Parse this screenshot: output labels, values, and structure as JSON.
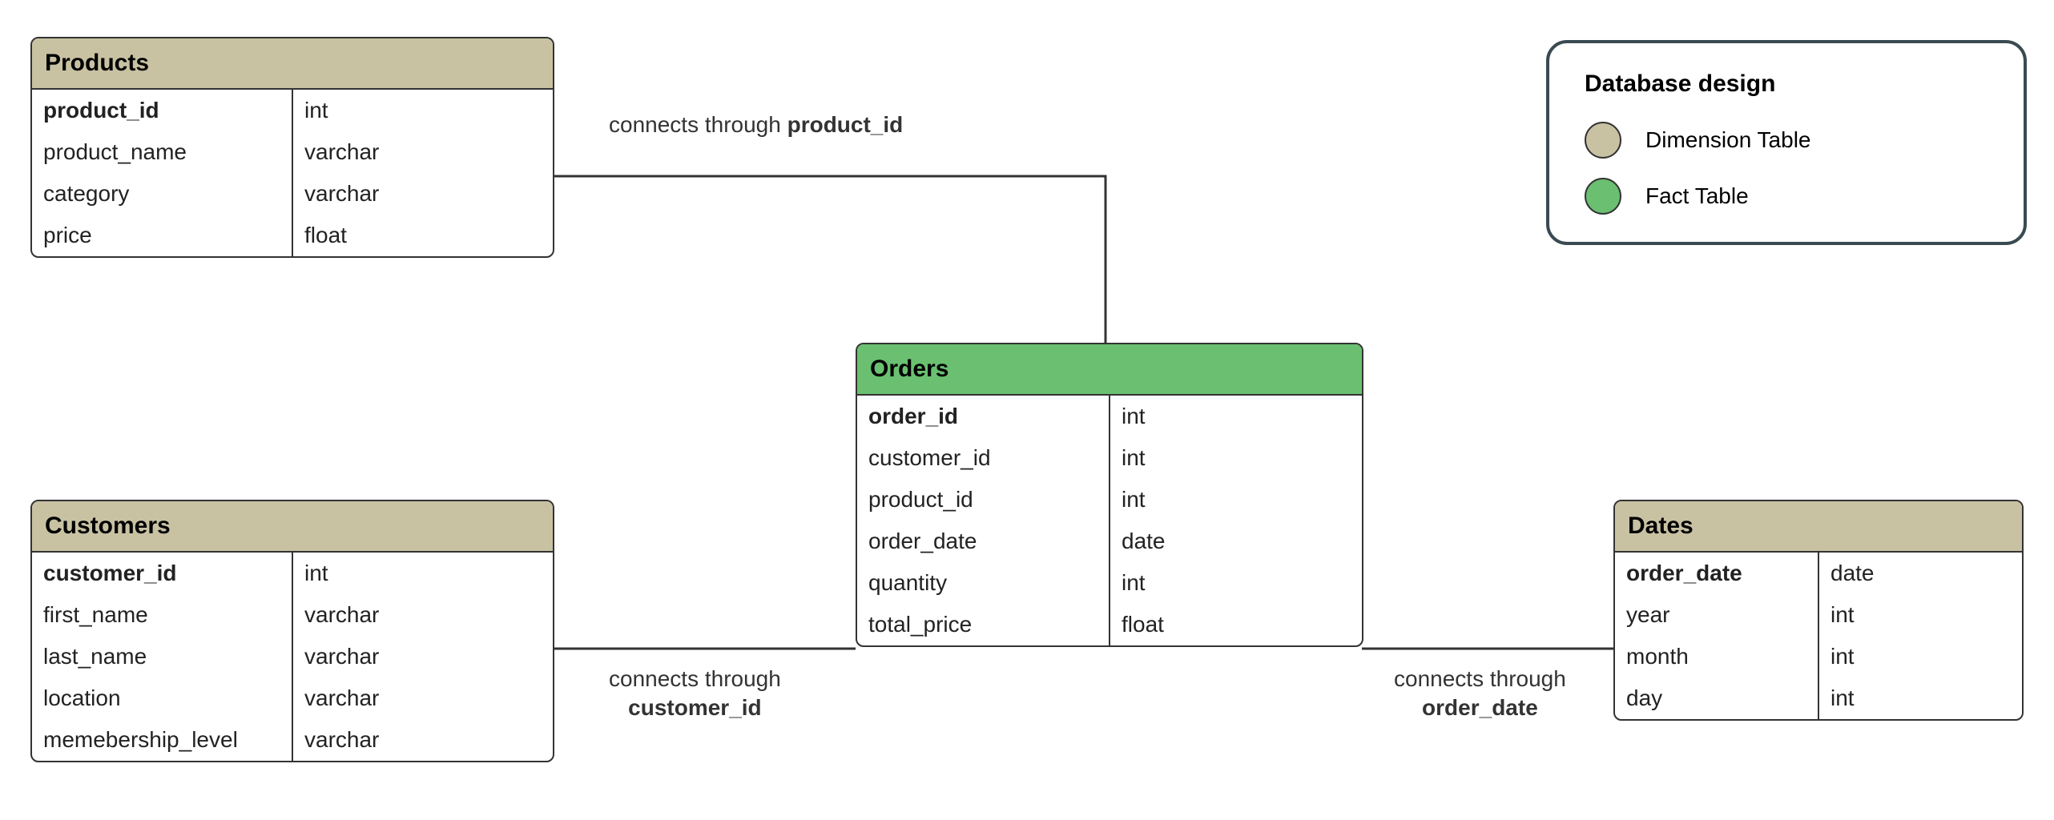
{
  "legend": {
    "title": "Database design",
    "dim_label": "Dimension Table",
    "fact_label": "Fact Table"
  },
  "conn": {
    "product": {
      "prefix": "connects through ",
      "key": "product_id"
    },
    "customer": {
      "prefix": "connects through ",
      "key": "customer_id"
    },
    "date": {
      "prefix": "connects through ",
      "key": "order_date"
    }
  },
  "tables": {
    "products": {
      "title": "Products",
      "rows": [
        {
          "name": "product_id",
          "type": "int",
          "pk": true
        },
        {
          "name": "product_name",
          "type": "varchar"
        },
        {
          "name": "category",
          "type": "varchar"
        },
        {
          "name": "price",
          "type": "float"
        }
      ]
    },
    "customers": {
      "title": "Customers",
      "rows": [
        {
          "name": "customer_id",
          "type": "int",
          "pk": true
        },
        {
          "name": "first_name",
          "type": "varchar"
        },
        {
          "name": "last_name",
          "type": "varchar"
        },
        {
          "name": "location",
          "type": "varchar"
        },
        {
          "name": "memebership_level",
          "type": "varchar"
        }
      ]
    },
    "orders": {
      "title": "Orders",
      "rows": [
        {
          "name": "order_id",
          "type": "int",
          "pk": true
        },
        {
          "name": "customer_id",
          "type": "int"
        },
        {
          "name": "product_id",
          "type": "int"
        },
        {
          "name": "order_date",
          "type": "date"
        },
        {
          "name": "quantity",
          "type": "int"
        },
        {
          "name": "total_price",
          "type": "float"
        }
      ]
    },
    "dates": {
      "title": "Dates",
      "rows": [
        {
          "name": "order_date",
          "type": "date",
          "pk": true
        },
        {
          "name": "year",
          "type": "int"
        },
        {
          "name": "month",
          "type": "int"
        },
        {
          "name": "day",
          "type": "int"
        }
      ]
    }
  }
}
